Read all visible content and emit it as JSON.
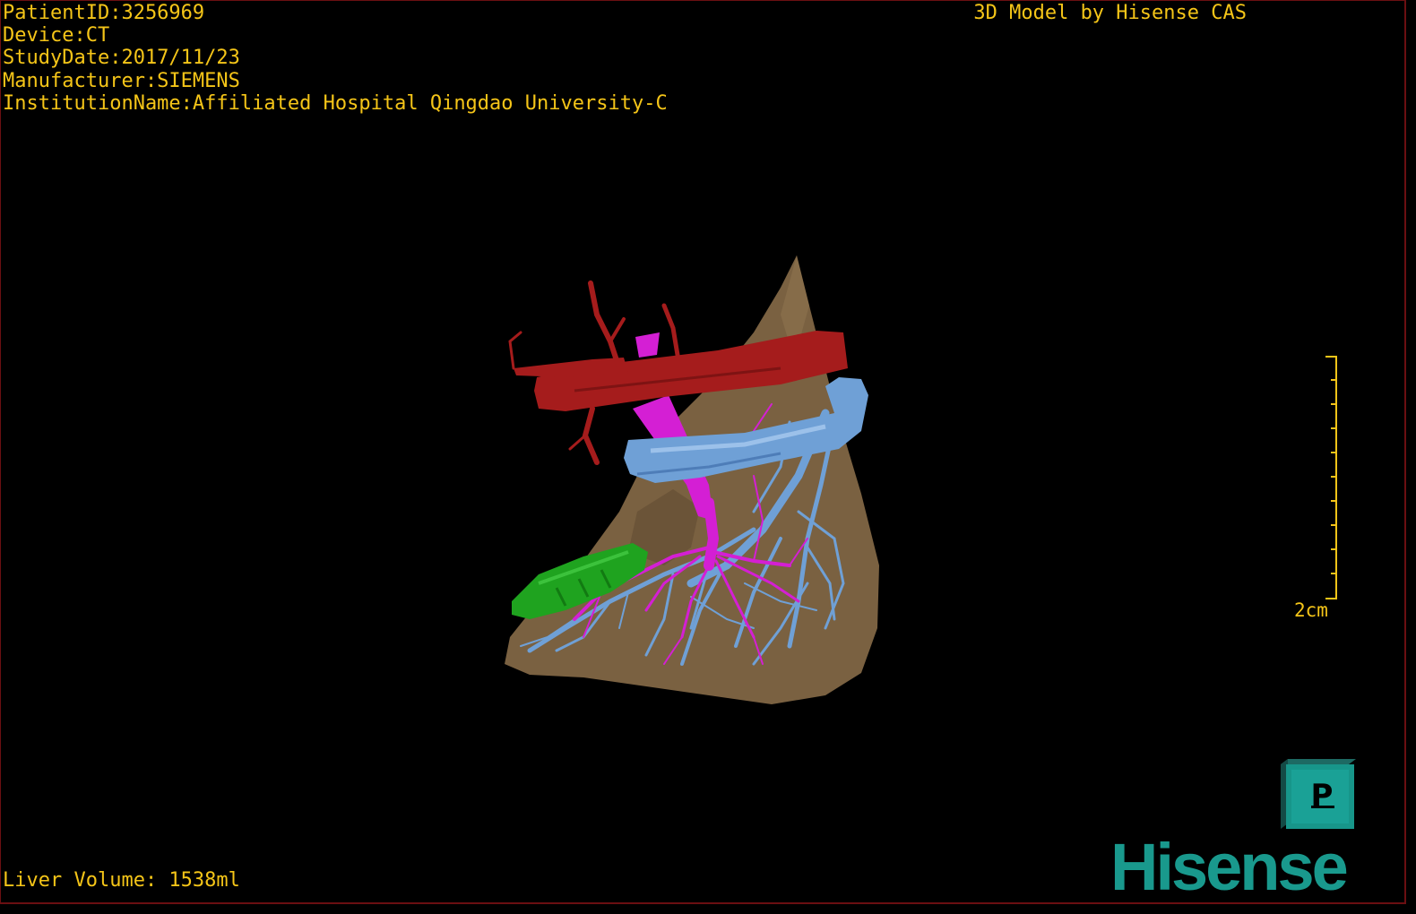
{
  "viewer": {
    "patient_id": "PatientID:3256969",
    "device": "Device:CT",
    "study_date": "StudyDate:2017/11/23",
    "manufacturer": "Manufacturer:SIEMENS",
    "institution": "InstitutionName:Affiliated Hospital Qingdao University-C",
    "credit": "3D Model by Hisense CAS",
    "liver_volume": "Liver Volume: 1538ml",
    "scale_label": "2cm",
    "orientation_label": "P",
    "brand": "Hisense"
  },
  "colors": {
    "overlay_text": "#f5c518",
    "liver": "#7a6141",
    "aorta": "#a51c1c",
    "portal_vein": "#d41fd4",
    "hepatic_vein": "#6fa0d6",
    "lesion": "#1fa31f",
    "brand": "#19998d",
    "border": "#6b0f12"
  },
  "icons": {
    "orientation_cube": "orientation-cube-icon",
    "scale_bar": "scale-bar-icon"
  }
}
